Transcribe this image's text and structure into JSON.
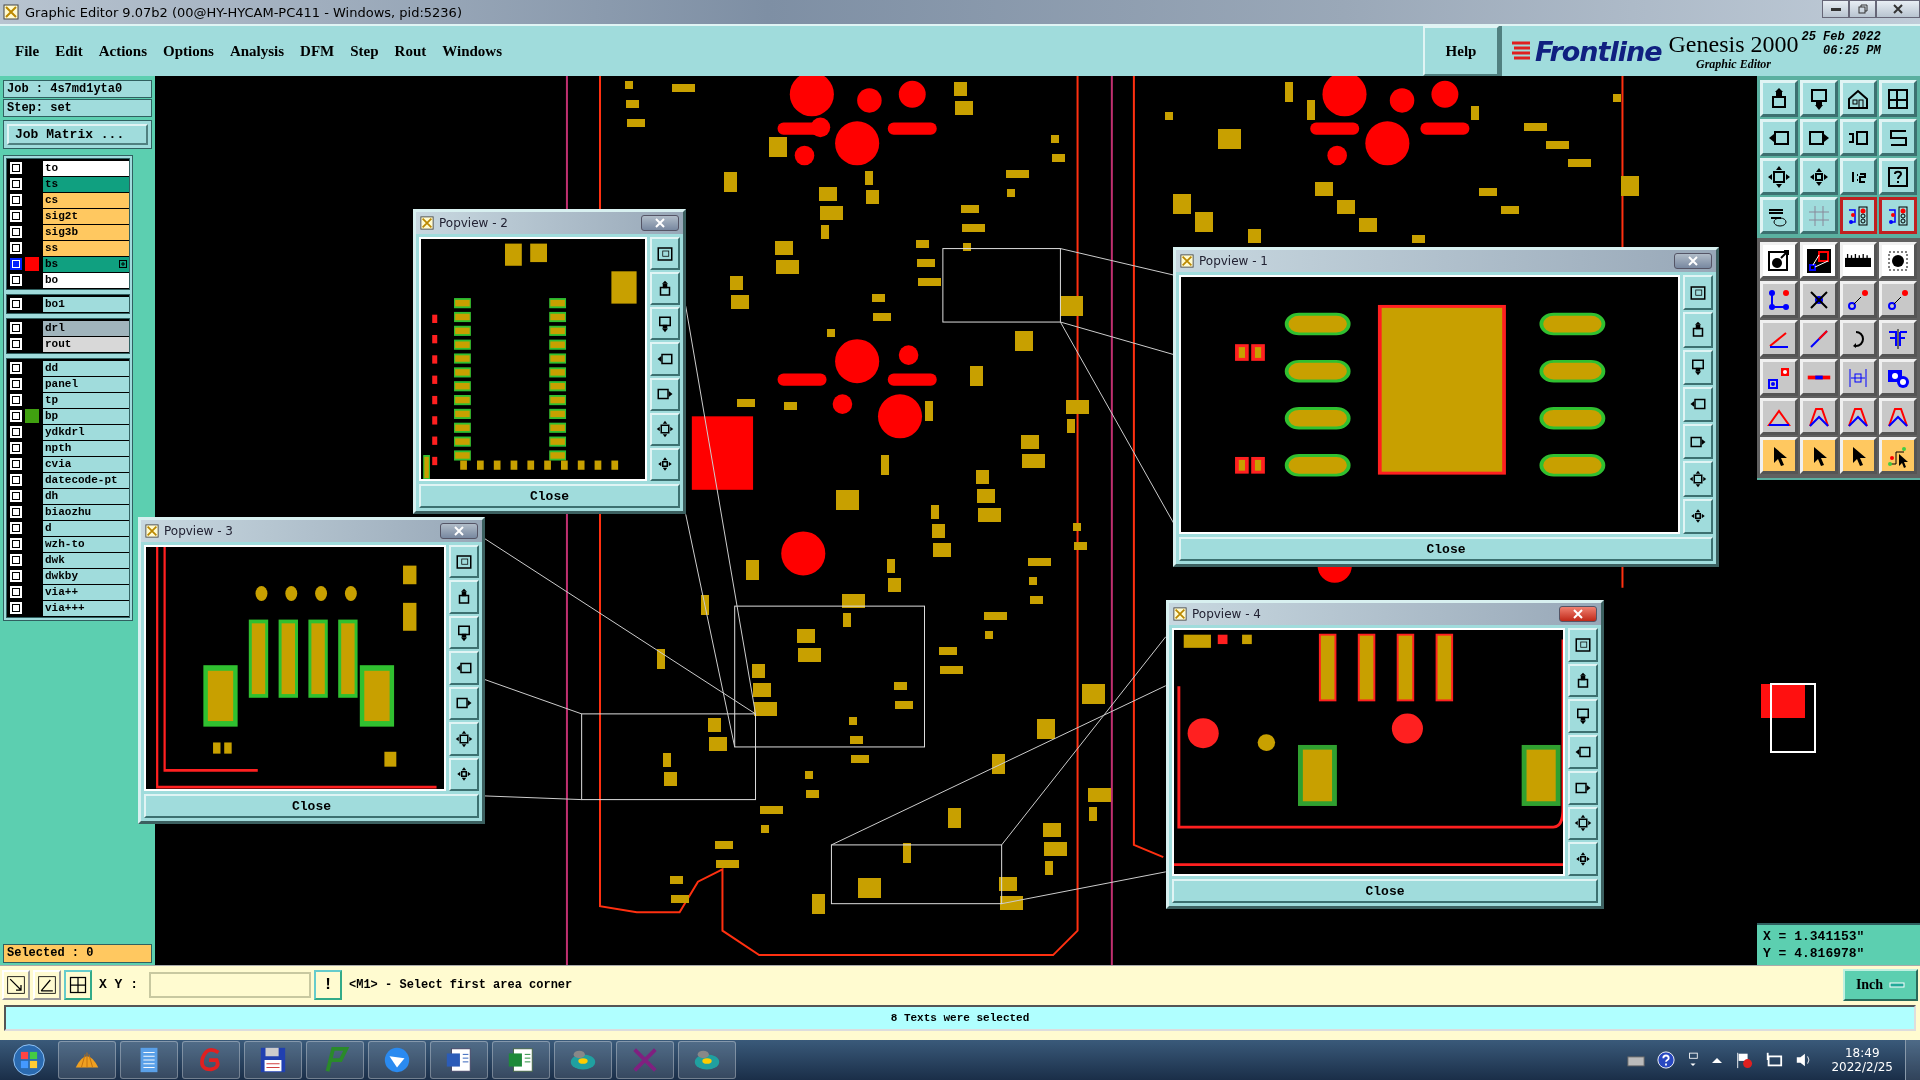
{
  "window": {
    "title": "Graphic Editor 9.07b2 (00@HY-HYCAM-PC411 - Windows, pid:5236)"
  },
  "menu": [
    "File",
    "Edit",
    "Actions",
    "Options",
    "Analysis",
    "DFM",
    "Step",
    "Rout",
    "Windows"
  ],
  "help": "Help",
  "brand": {
    "logo": "Frontline",
    "product": "Genesis 2000",
    "subtitle": "Graphic Editor",
    "date": "25 Feb 2022",
    "time": "06:25 PM"
  },
  "job": {
    "job": "Job : 4s7md1yta0",
    "step": "Step: set",
    "matrix_button": "Job Matrix ..."
  },
  "layer_groups": [
    {
      "layers": [
        {
          "name": "to",
          "kind": "silk",
          "selected": false
        },
        {
          "name": "ts",
          "kind": "mask",
          "selected": false
        },
        {
          "name": "cs",
          "kind": "signal",
          "selected": false
        },
        {
          "name": "sig2t",
          "kind": "signal",
          "selected": false
        },
        {
          "name": "sig3b",
          "kind": "signal",
          "selected": false
        },
        {
          "name": "ss",
          "kind": "signal",
          "selected": false
        },
        {
          "name": "bs",
          "kind": "mask",
          "selected": true,
          "color": "#ff0000"
        },
        {
          "name": "bo",
          "kind": "silk",
          "selected": false
        }
      ]
    },
    {
      "layers": [
        {
          "name": "bo1",
          "kind": "misc",
          "selected": false
        }
      ]
    },
    {
      "layers": [
        {
          "name": "drl",
          "kind": "drill",
          "selected": false
        },
        {
          "name": "rout",
          "kind": "rout",
          "selected": false
        }
      ]
    },
    {
      "layers": [
        {
          "name": "dd",
          "kind": "misc",
          "selected": false
        },
        {
          "name": "panel",
          "kind": "misc",
          "selected": false
        },
        {
          "name": "tp",
          "kind": "misc",
          "selected": false
        },
        {
          "name": "bp",
          "kind": "misc",
          "selected": false,
          "color": "#40a010"
        },
        {
          "name": "ydkdrl",
          "kind": "misc",
          "selected": false
        },
        {
          "name": "npth",
          "kind": "misc",
          "selected": false
        },
        {
          "name": "cvia",
          "kind": "misc",
          "selected": false
        },
        {
          "name": "datecode-pt",
          "kind": "misc",
          "selected": false
        },
        {
          "name": "dh",
          "kind": "misc",
          "selected": false
        },
        {
          "name": "biaozhu",
          "kind": "misc",
          "selected": false
        },
        {
          "name": "d",
          "kind": "misc",
          "selected": false
        },
        {
          "name": "wzh-to",
          "kind": "misc",
          "selected": false
        },
        {
          "name": "dwk",
          "kind": "misc",
          "selected": false
        },
        {
          "name": "dwkby",
          "kind": "misc",
          "selected": false
        },
        {
          "name": "via++",
          "kind": "misc",
          "selected": false
        },
        {
          "name": "via+++",
          "kind": "misc",
          "selected": false
        }
      ]
    }
  ],
  "selected_count": "Selected : 0",
  "view_tools": [
    {
      "on": false
    },
    {
      "on": false
    },
    {
      "on": false
    },
    {
      "on": false
    },
    {
      "on": false
    },
    {
      "on": false
    },
    {
      "on": false
    },
    {
      "on": false
    },
    {
      "on": false
    },
    {
      "on": false
    },
    {
      "on": false
    },
    {
      "on": false
    },
    {
      "on": false
    },
    {
      "on": false
    },
    {
      "on": true
    },
    {
      "on": true
    }
  ],
  "popviews": [
    {
      "title": "Popview - 2",
      "kind": "qfn",
      "active": false,
      "close": "Close"
    },
    {
      "title": "Popview - 1",
      "kind": "soic",
      "active": false,
      "close": "Close"
    },
    {
      "title": "Popview - 3",
      "kind": "connector",
      "active": false,
      "close": "Close"
    },
    {
      "title": "Popview - 4",
      "kind": "pads",
      "active": true,
      "close": "Close"
    }
  ],
  "coords": {
    "x": "X = 1.341153\"",
    "y": "Y = 4.816978\""
  },
  "command_bar": {
    "label": "X Y :",
    "confirm": "!",
    "prompt": "<M1> - Select first area corner",
    "units": "Inch"
  },
  "status": "8 Texts were selected",
  "taskbar": {
    "time": "18:49",
    "date": "2022/2/25"
  }
}
